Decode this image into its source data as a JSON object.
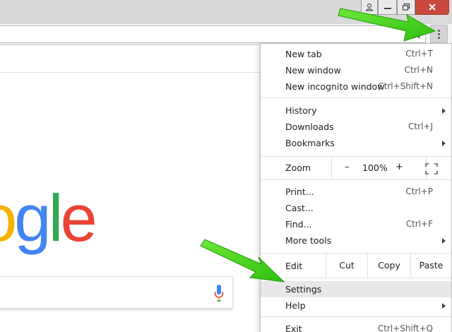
{
  "menu": {
    "items": [
      {
        "label": "New tab",
        "shortcut": "Ctrl+T"
      },
      {
        "label": "New window",
        "shortcut": "Ctrl+N"
      },
      {
        "label": "New incognito window",
        "shortcut": "Ctrl+Shift+N"
      },
      {
        "label": "History",
        "shortcut": ""
      },
      {
        "label": "Downloads",
        "shortcut": "Ctrl+J"
      },
      {
        "label": "Bookmarks",
        "shortcut": ""
      },
      {
        "label": "Print...",
        "shortcut": "Ctrl+P"
      },
      {
        "label": "Cast...",
        "shortcut": ""
      },
      {
        "label": "Find...",
        "shortcut": "Ctrl+F"
      },
      {
        "label": "More tools",
        "shortcut": ""
      },
      {
        "label": "Settings",
        "shortcut": ""
      },
      {
        "label": "Help",
        "shortcut": ""
      },
      {
        "label": "Exit",
        "shortcut": "Ctrl+Shift+Q"
      }
    ],
    "zoom": {
      "label": "Zoom",
      "minus": "–",
      "value": "100%",
      "plus": "+"
    },
    "edit": {
      "label": "Edit",
      "cut": "Cut",
      "copy": "Copy",
      "paste": "Paste"
    },
    "highlighted_item": "Settings"
  },
  "page": {
    "logo_letters": [
      "o",
      "g",
      "l",
      "e"
    ]
  },
  "icons": {
    "star": "bookmark-star-icon",
    "menu": "three-dot-menu-icon",
    "mic": "microphone-icon",
    "fullscreen": "fullscreen-icon",
    "profile": "profile-icon",
    "minimize": "minimize-icon",
    "maximize": "restore-icon",
    "close": "close-icon"
  },
  "colors": {
    "arrow_annotation": "#4cd21e",
    "google_blue": "#4285f4",
    "google_red": "#ea4335",
    "google_yellow": "#f4b400",
    "google_green": "#34a853",
    "close_button": "#c9483d",
    "menu_highlight": "#e8e8e8"
  }
}
